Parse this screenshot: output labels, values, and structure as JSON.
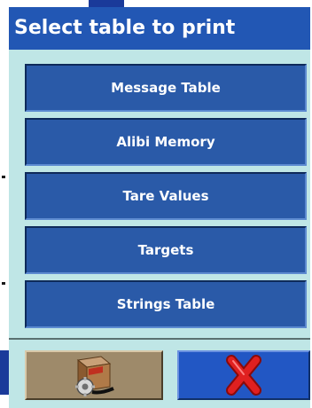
{
  "dialog": {
    "title": "Select table to print"
  },
  "menu": {
    "items": [
      {
        "label": "Message Table"
      },
      {
        "label": "Alibi Memory"
      },
      {
        "label": "Tare Values"
      },
      {
        "label": "Targets"
      },
      {
        "label": "Strings Table"
      }
    ]
  },
  "footer": {
    "print_icon": "printer-box-icon",
    "cancel_icon": "red-x-cancel-icon"
  },
  "colors": {
    "title_bar": "#2257b4",
    "dialog_bg": "#bfe6e6",
    "menu_button": "#2a5aa8",
    "print_button": "#9e8a6a",
    "cancel_button": "#2257c4",
    "cancel_x": "#e02020"
  }
}
